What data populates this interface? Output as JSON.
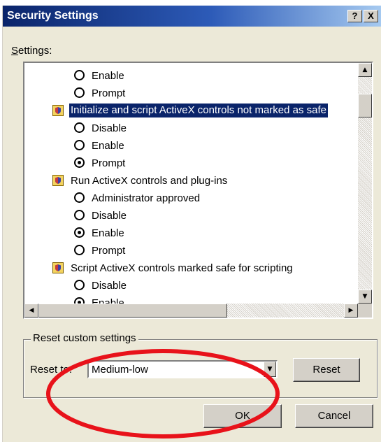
{
  "window": {
    "title": "Security Settings",
    "help_button": "?",
    "close_button": "X"
  },
  "settings_label": "Settings:",
  "list_items": [
    {
      "kind": "radio",
      "label": "Enable",
      "checked": false
    },
    {
      "kind": "radio",
      "label": "Prompt",
      "checked": false
    },
    {
      "kind": "group",
      "label": "Initialize and script ActiveX controls not marked as safe",
      "selected": true,
      "icon": "shield-icon"
    },
    {
      "kind": "radio",
      "label": "Disable",
      "checked": false
    },
    {
      "kind": "radio",
      "label": "Enable",
      "checked": false
    },
    {
      "kind": "radio",
      "label": "Prompt",
      "checked": true
    },
    {
      "kind": "group",
      "label": "Run ActiveX controls and plug-ins",
      "selected": false,
      "icon": "shield-icon"
    },
    {
      "kind": "radio",
      "label": "Administrator approved",
      "checked": false
    },
    {
      "kind": "radio",
      "label": "Disable",
      "checked": false
    },
    {
      "kind": "radio",
      "label": "Enable",
      "checked": true
    },
    {
      "kind": "radio",
      "label": "Prompt",
      "checked": false
    },
    {
      "kind": "group",
      "label": "Script ActiveX controls marked safe for scripting",
      "selected": false,
      "icon": "shield-icon"
    },
    {
      "kind": "radio",
      "label": "Disable",
      "checked": false
    },
    {
      "kind": "radio",
      "label": "Enable",
      "checked": true
    }
  ],
  "reset_group": {
    "legend": "Reset custom settings",
    "reset_to_label": "Reset to:",
    "reset_to_value": "Medium-low",
    "reset_button": "Reset"
  },
  "footer": {
    "ok_button": "OK",
    "cancel_button": "Cancel"
  },
  "colors": {
    "selection": "#0a246a",
    "annotation_circle": "#e8121a"
  }
}
